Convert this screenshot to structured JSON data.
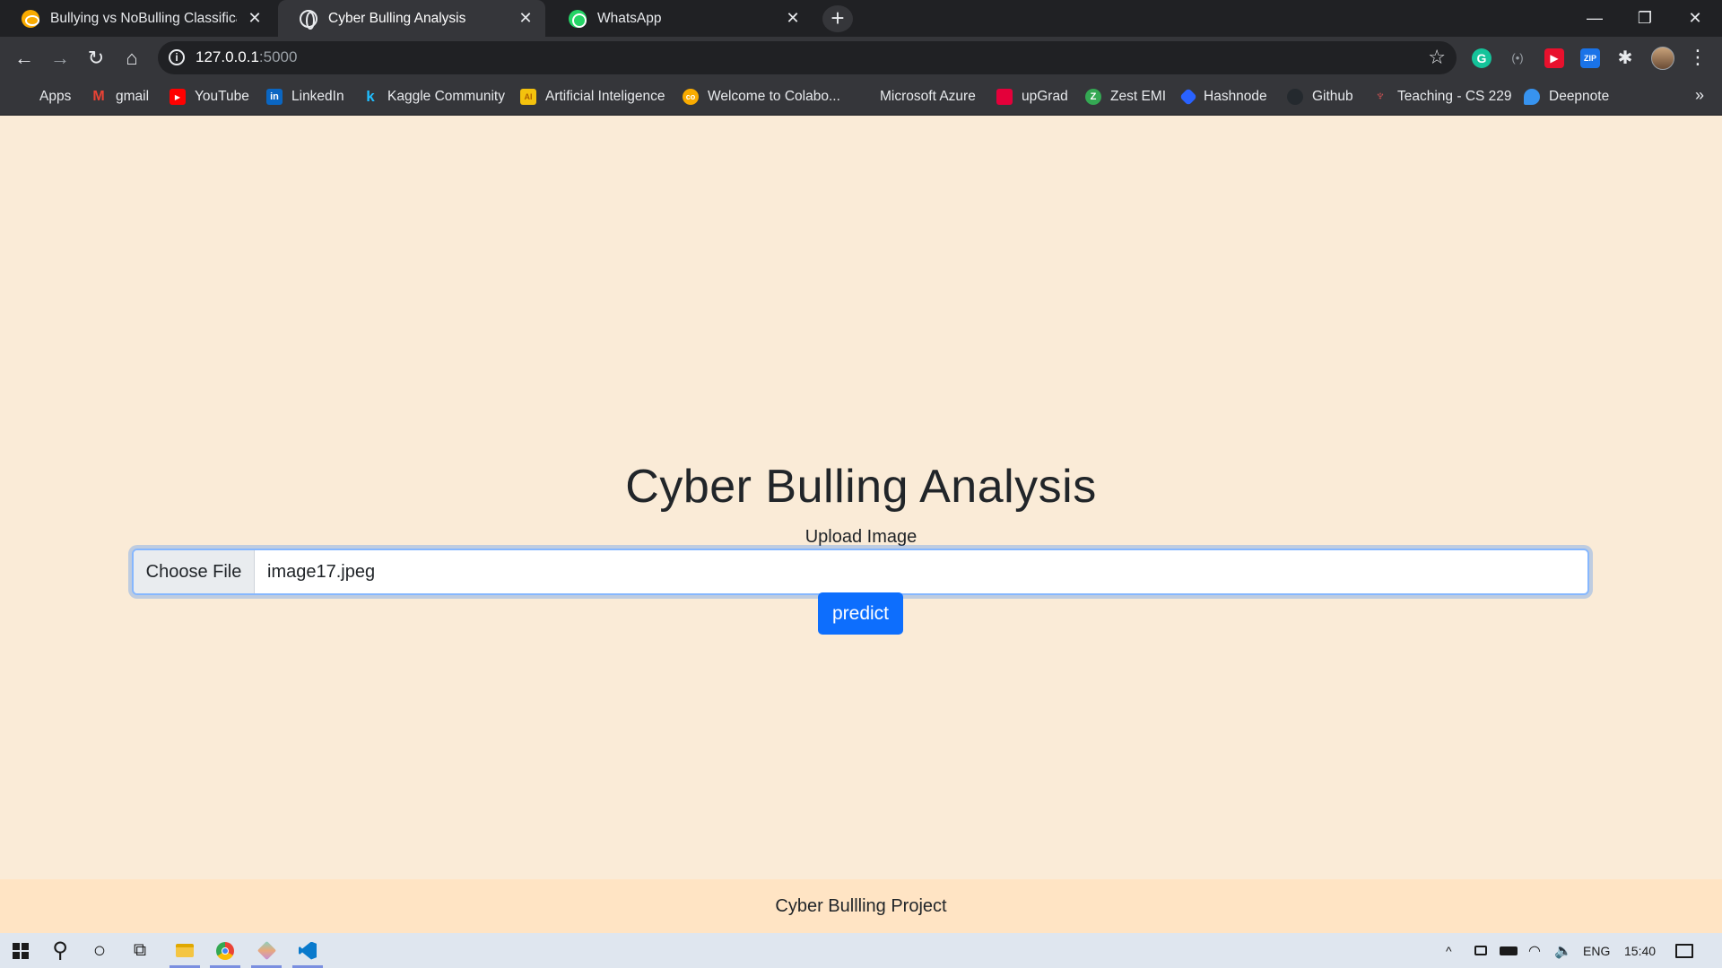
{
  "browser": {
    "tabs": [
      {
        "title": "Bullying vs NoBulling Classificatio",
        "icon": "colab-icon",
        "active": false
      },
      {
        "title": "Cyber Bulling Analysis",
        "icon": "globe-icon",
        "active": true
      },
      {
        "title": "WhatsApp",
        "icon": "whatsapp-icon",
        "active": false
      }
    ],
    "close_glyph": "✕",
    "new_tab_glyph": "+",
    "window_controls": {
      "minimize": "—",
      "restore": "❐",
      "close": "✕"
    },
    "nav": {
      "back": "←",
      "forward": "→",
      "reload": "↻",
      "home": "⌂"
    },
    "address": {
      "host": "127.0.0.1",
      "port": ":5000",
      "info_glyph": "i",
      "star_glyph": "☆"
    },
    "extensions": {
      "grammarly": "G",
      "cast": "(•)",
      "red": "▶",
      "zip": "ZIP",
      "puzzle": "✱"
    },
    "menu_glyph": "⋮",
    "bookmarks": [
      {
        "label": "Apps",
        "icon": "apps-icon",
        "color": "#e8eaed"
      },
      {
        "label": "gmail",
        "icon": "gmail-icon",
        "color": "#ea4335"
      },
      {
        "label": "YouTube",
        "icon": "youtube-icon",
        "color": "#ff0000"
      },
      {
        "label": "LinkedIn",
        "icon": "linkedin-icon",
        "color": "#0a66c2"
      },
      {
        "label": "Kaggle Community",
        "icon": "kaggle-icon",
        "color": "#20beff"
      },
      {
        "label": "Artificial Inteligence",
        "icon": "ai-icon",
        "color": "#f4c20d"
      },
      {
        "label": "Welcome to Colabo...",
        "icon": "colab-icon",
        "color": "#f9ab00"
      },
      {
        "label": "Microsoft Azure",
        "icon": "microsoft-icon",
        "color": "#f25022"
      },
      {
        "label": "upGrad",
        "icon": "upgrad-icon",
        "color": "#e4003a"
      },
      {
        "label": "Zest EMI",
        "icon": "zest-icon",
        "color": "#34a853"
      },
      {
        "label": "Hashnode",
        "icon": "hashnode-icon",
        "color": "#2962ff"
      },
      {
        "label": "Github",
        "icon": "github-icon",
        "color": "#24292e"
      },
      {
        "label": "Teaching - CS 229",
        "icon": "stanford-icon",
        "color": "#8c1515"
      },
      {
        "label": "Deepnote",
        "icon": "deepnote-icon",
        "color": "#3793ef"
      }
    ],
    "bookmarks_more": "»"
  },
  "page": {
    "title": "Cyber Bulling Analysis",
    "upload_label": "Upload Image",
    "choose_file_label": "Choose File",
    "file_name": "image17.jpeg",
    "predict_label": "predict",
    "footer_text": "Cyber Bullling Project",
    "colors": {
      "background": "#faebd7",
      "footer": "#ffe4c4",
      "primary": "#0d6efd"
    }
  },
  "taskbar": {
    "search_glyph": "⚲",
    "cortana_glyph": "○",
    "taskview_glyph": "⧉",
    "apps": [
      "file-explorer-icon",
      "chrome-icon",
      "git-icon",
      "vscode-icon"
    ],
    "tray": {
      "chevron": "^",
      "language": "ENG",
      "time": "15:40",
      "notifications_glyph": "🗨"
    }
  }
}
